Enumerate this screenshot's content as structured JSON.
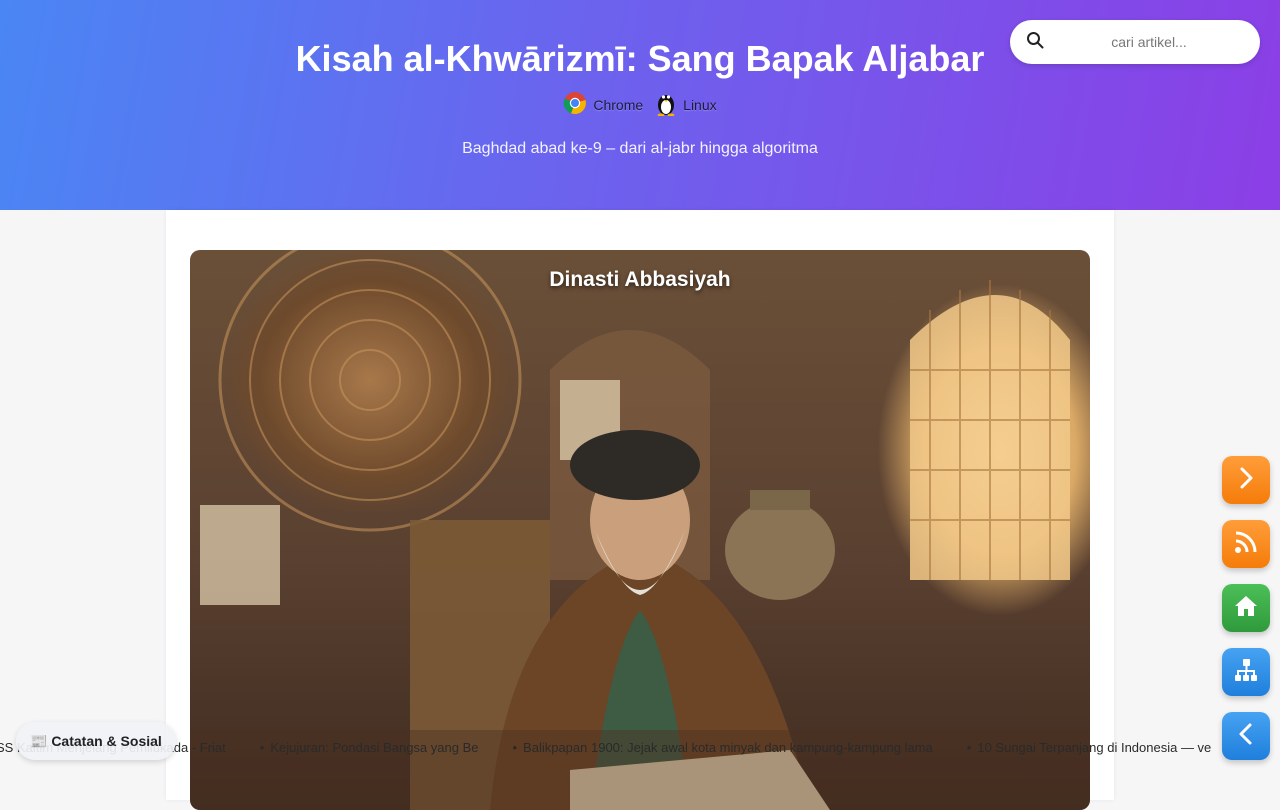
{
  "header": {
    "title": "Kisah al-Khwārizmī: Sang Bapak Aljabar",
    "subtitle": "Baghdad abad ke-9 – dari al-jabr hingga algoritma",
    "env": [
      {
        "label": "Chrome",
        "icon": "chrome-icon"
      },
      {
        "label": "Linux",
        "icon": "linux-tux-icon"
      }
    ]
  },
  "search": {
    "placeholder": "cari artikel...",
    "value": "",
    "icon": "search-icon"
  },
  "hero": {
    "caption": "Dinasti Abbasiyah"
  },
  "side_buttons": [
    {
      "icon": "chevron-right-icon",
      "color": "#ff8a1f"
    },
    {
      "icon": "rss-icon",
      "color": "#ff8a1f"
    },
    {
      "icon": "home-icon",
      "color": "#3da748"
    },
    {
      "icon": "sitemap-icon",
      "color": "#2e8ee8"
    },
    {
      "icon": "chevron-left-icon",
      "color": "#2e8ee8"
    }
  ],
  "ticker": {
    "pill_label": "📰 Catatan & Sosial",
    "items": [
      "SS Kaltim Menjelang Pemilukada - Friat",
      "Kejujuran: Pondasi Bangsa yang Be",
      "Balikpapan 1900: Jejak awal kota minyak dan kampung-kampung lama",
      "10 Sungai Terpanjang di Indonesia — ve"
    ]
  }
}
